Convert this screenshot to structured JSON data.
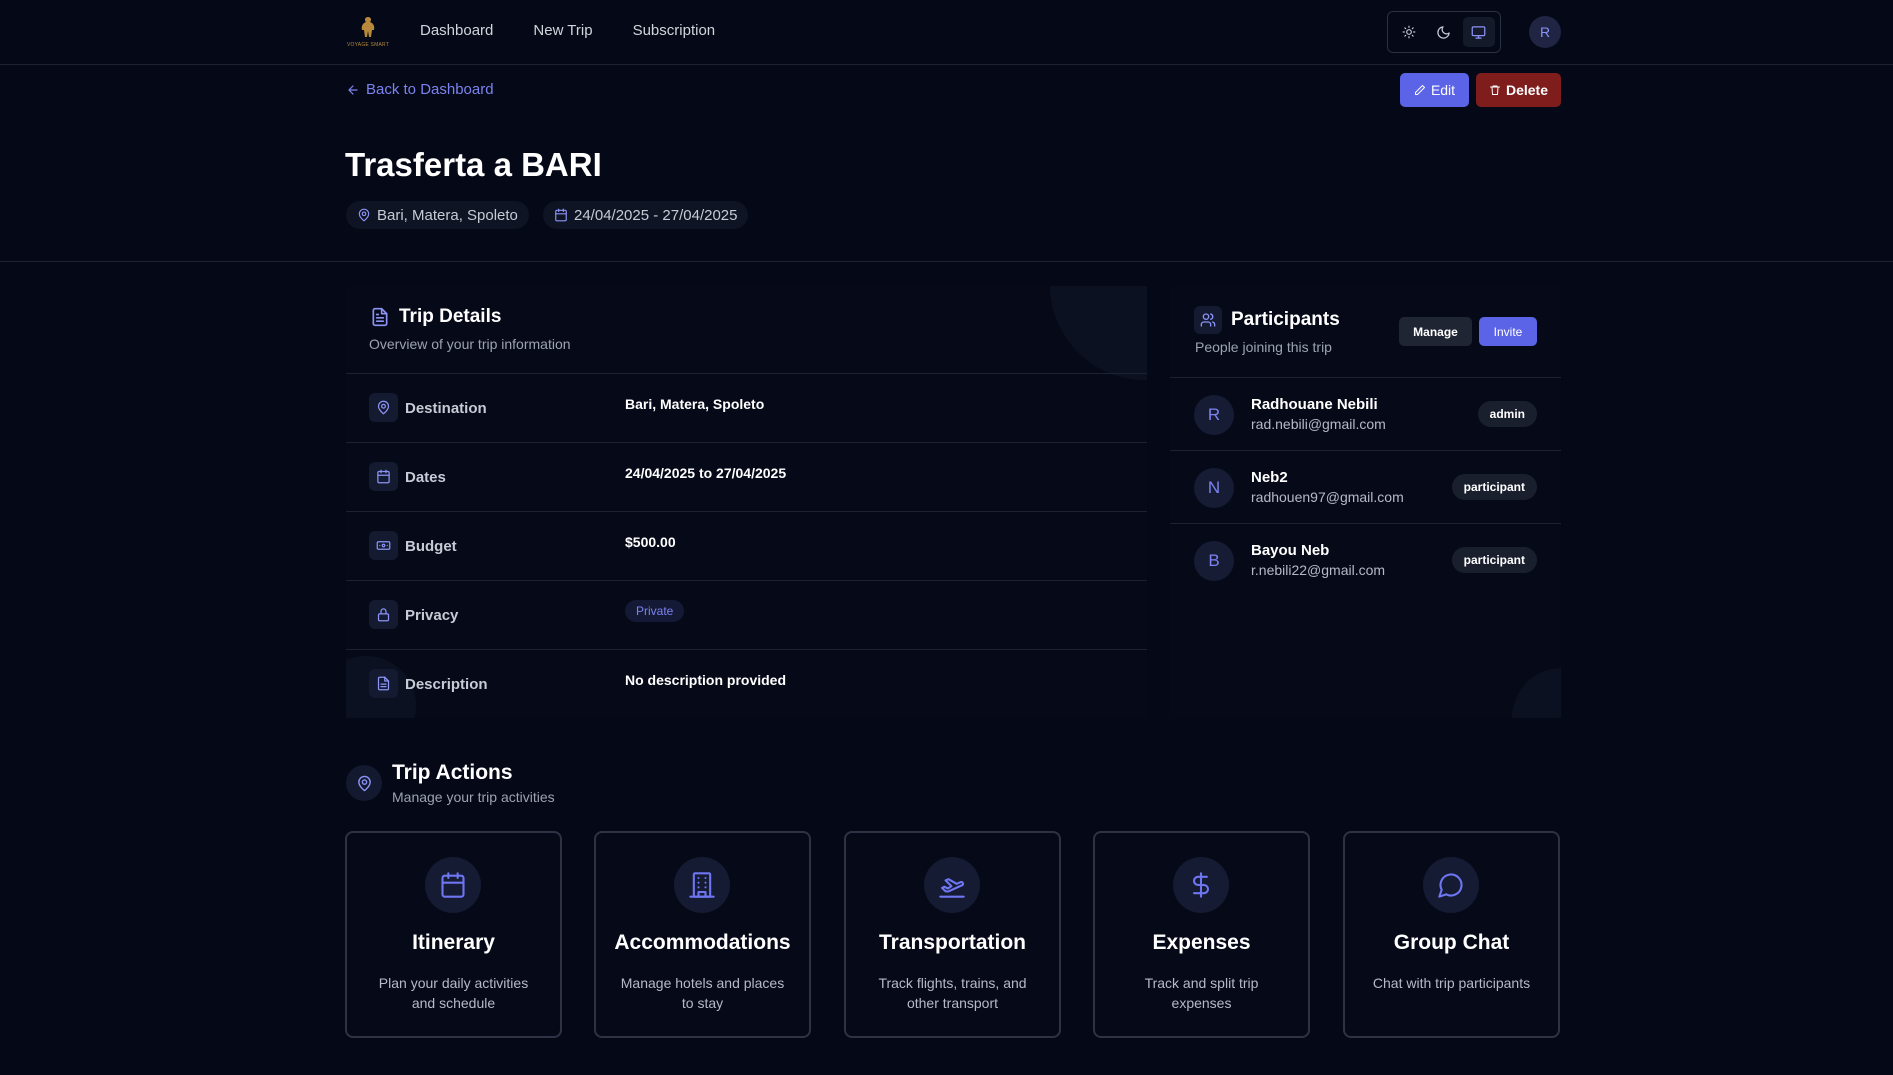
{
  "nav": {
    "logo_text": "VOYAGE SMART",
    "links": [
      "Dashboard",
      "New Trip",
      "Subscription"
    ],
    "theme_options": [
      "light-theme",
      "dark-theme",
      "system-theme"
    ],
    "user_initial": "R"
  },
  "header": {
    "back_label": "Back to Dashboard",
    "edit_label": "Edit",
    "delete_label": "Delete",
    "title": "Trasferta a BARI",
    "location": "Bari, Matera, Spoleto",
    "date_range": "24/04/2025 - 27/04/2025"
  },
  "details": {
    "title": "Trip Details",
    "subtitle": "Overview of your trip information",
    "rows": [
      {
        "label": "Destination",
        "value": "Bari, Matera, Spoleto",
        "icon": "map-pin-icon"
      },
      {
        "label": "Dates",
        "value": "24/04/2025 to 27/04/2025",
        "icon": "calendar-icon"
      },
      {
        "label": "Budget",
        "value": "$500.00",
        "icon": "banknote-icon"
      },
      {
        "label": "Privacy",
        "value": "Private",
        "icon": "lock-icon"
      },
      {
        "label": "Description",
        "value": "No description provided",
        "icon": "file-text-icon"
      }
    ]
  },
  "participants": {
    "title": "Participants",
    "subtitle": "People joining this trip",
    "manage_label": "Manage",
    "invite_label": "Invite",
    "list": [
      {
        "initial": "R",
        "name": "Radhouane Nebili",
        "email": "rad.nebili@gmail.com",
        "role": "admin"
      },
      {
        "initial": "N",
        "name": "Neb2",
        "email": "radhouen97@gmail.com",
        "role": "participant"
      },
      {
        "initial": "B",
        "name": "Bayou Neb",
        "email": "r.nebili22@gmail.com",
        "role": "participant"
      }
    ]
  },
  "actions": {
    "title": "Trip Actions",
    "subtitle": "Manage your trip activities",
    "cards": [
      {
        "title": "Itinerary",
        "desc": "Plan your daily activities and schedule",
        "icon": "calendar-icon"
      },
      {
        "title": "Accommodations",
        "desc": "Manage hotels and places to stay",
        "icon": "building-icon"
      },
      {
        "title": "Transportation",
        "desc": "Track flights, trains, and other transport",
        "icon": "plane-icon"
      },
      {
        "title": "Expenses",
        "desc": "Track and split trip expenses",
        "icon": "dollar-icon"
      },
      {
        "title": "Group Chat",
        "desc": "Chat with trip participants",
        "icon": "chat-icon"
      }
    ]
  },
  "colors": {
    "background": "#050816",
    "accent": "#5b63e6",
    "accent_text": "#7c83f0",
    "danger": "#7f1d1d"
  }
}
